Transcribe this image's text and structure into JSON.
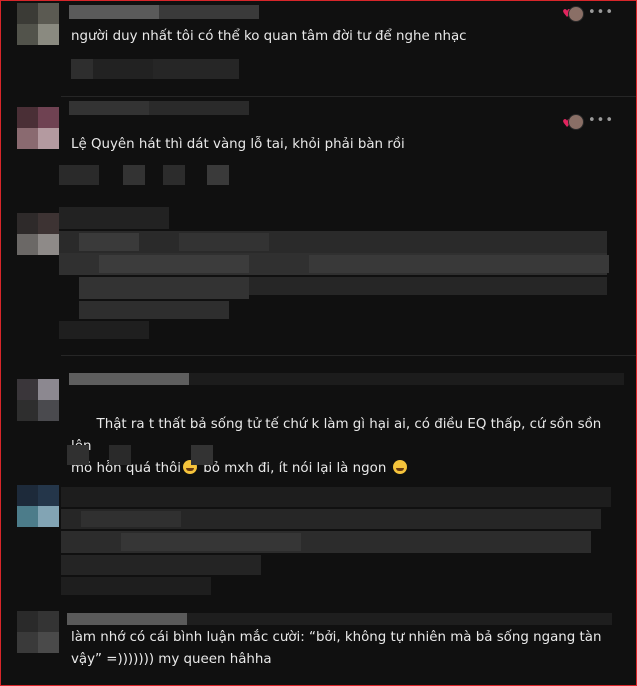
{
  "comments": [
    {
      "text": "người duy nhất tôi có thể ko quan tâm đời tư để nghe nhạc",
      "reaction_icon": "heart",
      "menu": "•••"
    },
    {
      "text": "Lệ Quyên hát thì dát vàng lỗ tai, khỏi phải bàn rồi",
      "reaction_icon": "heart",
      "menu": "•••"
    },
    {
      "text": ""
    },
    {
      "text": "Thật ra t thất bả sống tử tế chứ k làm gì hại ai, có điều EQ thấp, cứ sồn sồn lên\nmỏ hỗn quá thôi",
      "text_after_emoji1": " bỏ mxh đi, ít nói lại là ngon ",
      "emoji": "rolling-on-floor-laughing"
    },
    {
      "text": ""
    },
    {
      "text": "làm nhớ có cái bình luận mắc cười: “bởi, không tự nhiên mà bả sống ngang tàn\nvậy” =))))))) my queen hâhha"
    }
  ],
  "colors": {
    "border": "#d8262a",
    "heart": "#e0245e",
    "background": "#101010",
    "text": "#e9e9e9"
  }
}
